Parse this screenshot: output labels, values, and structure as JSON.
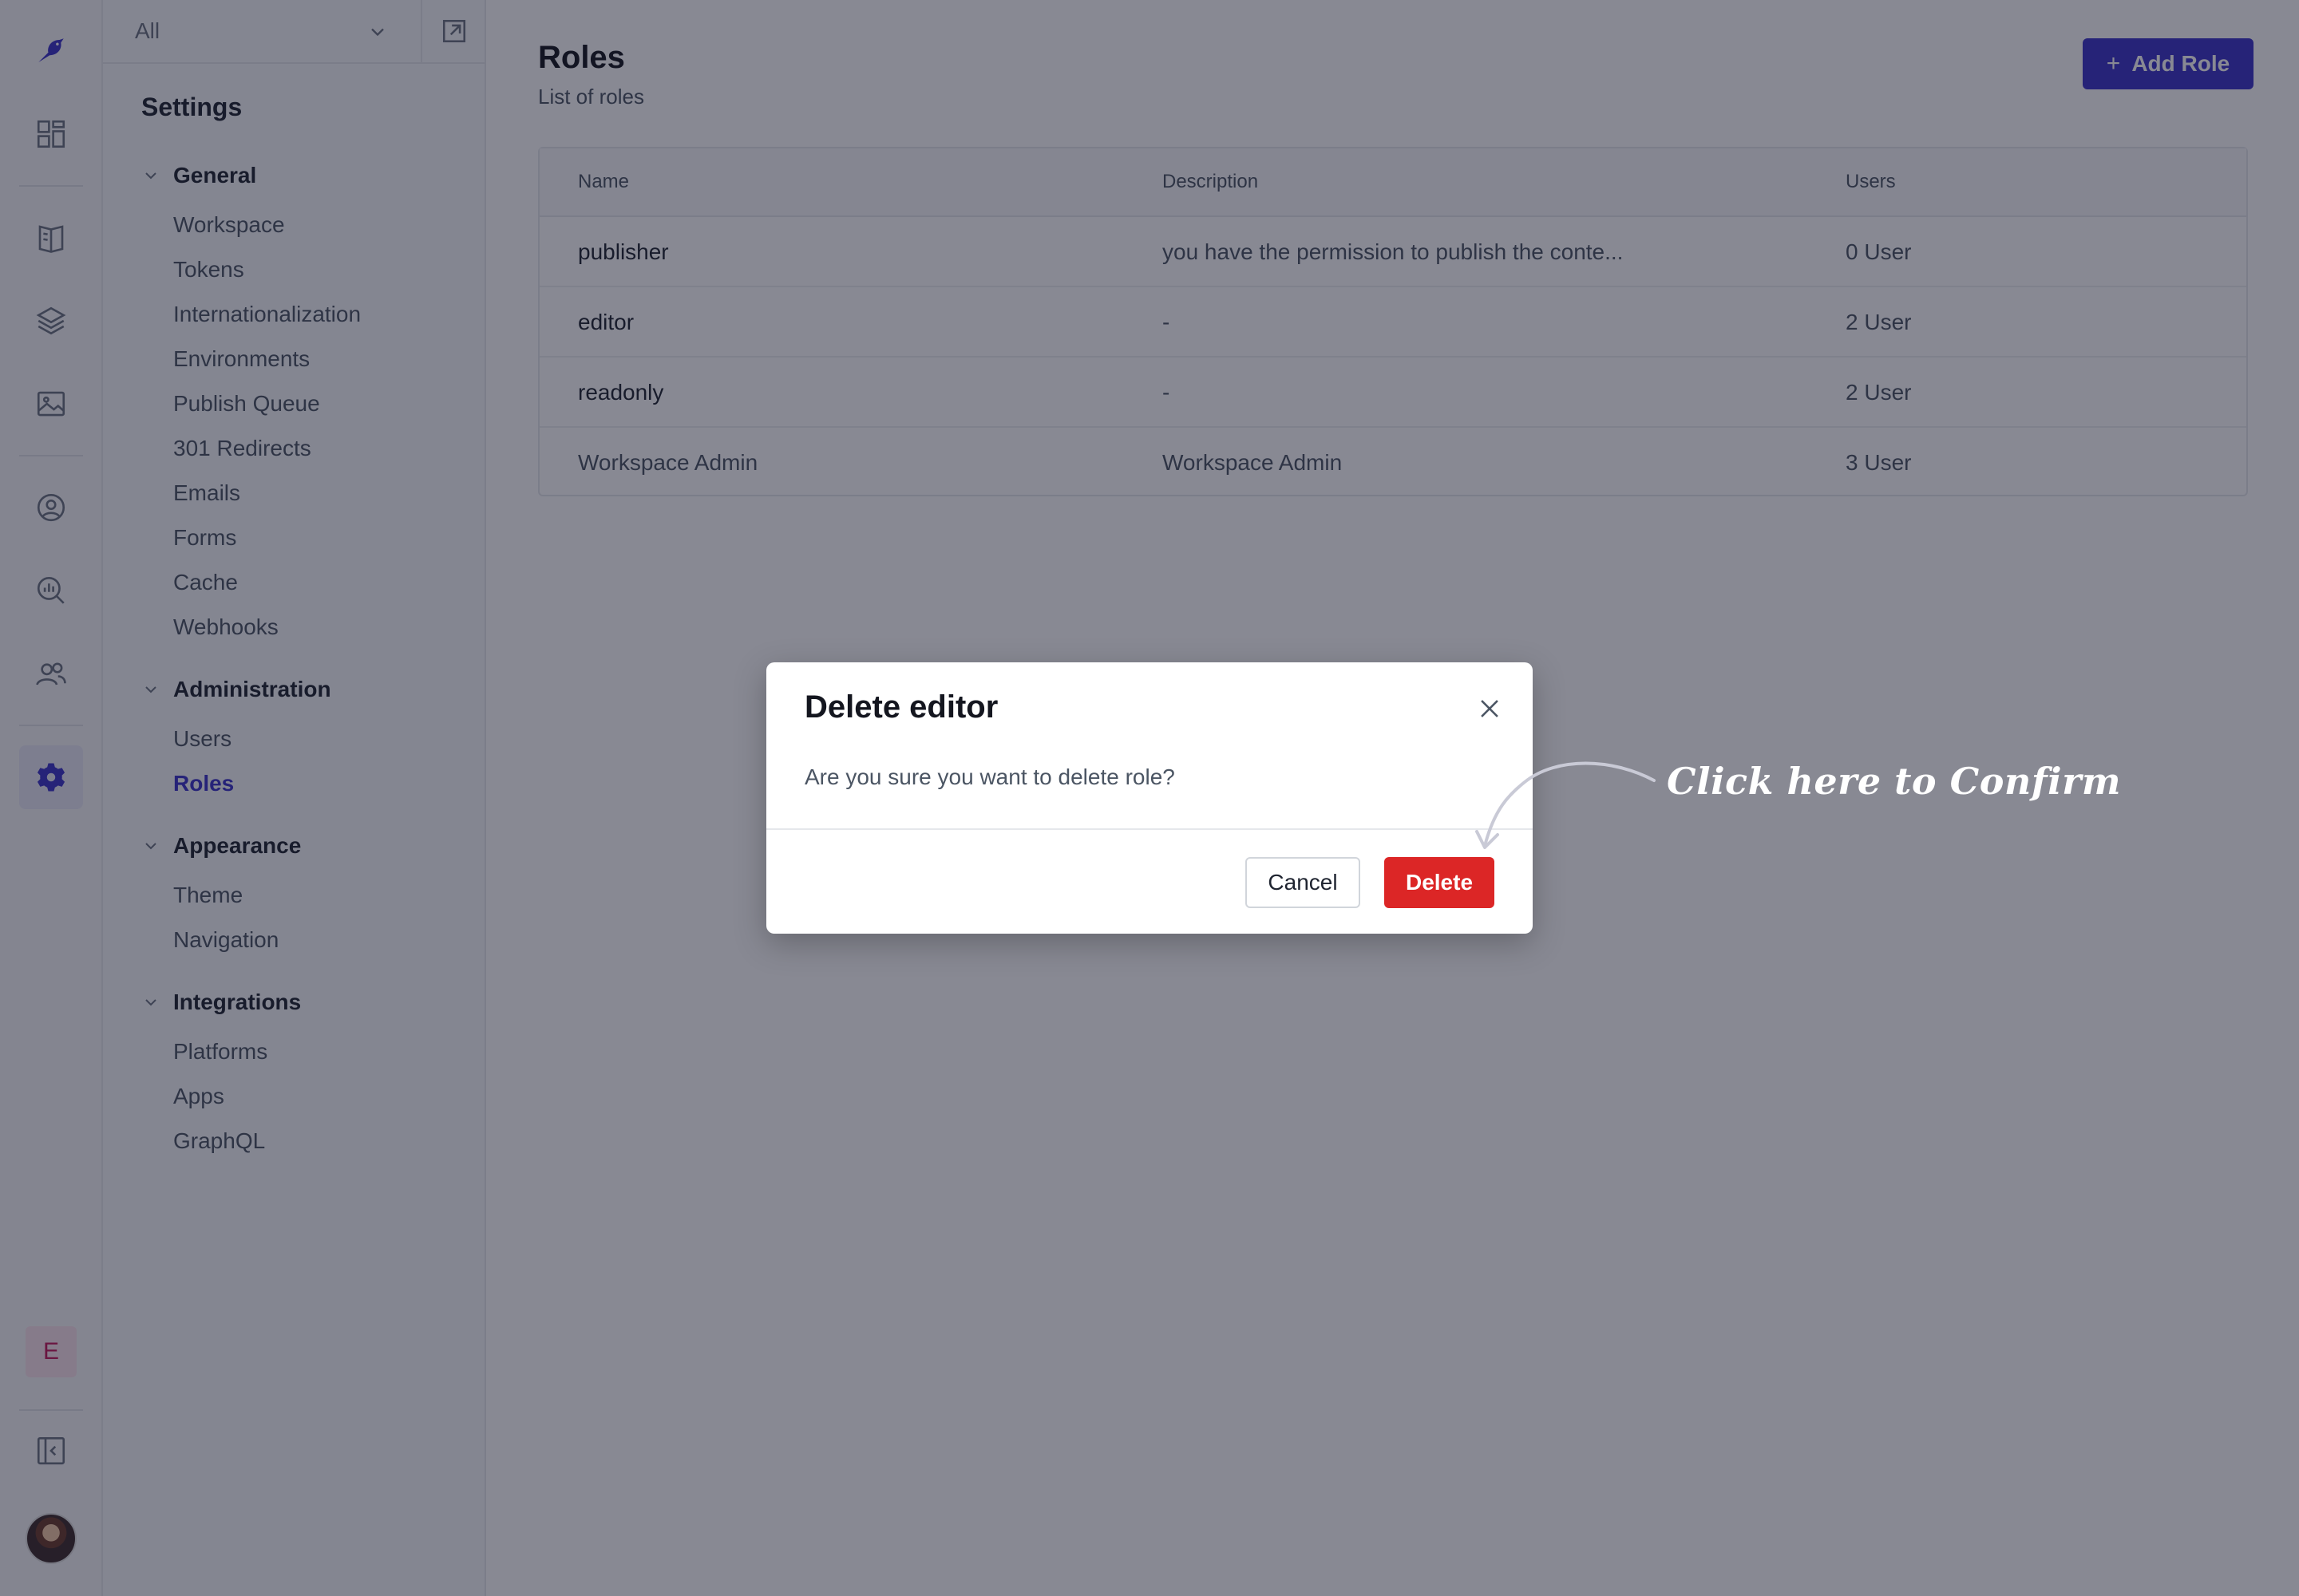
{
  "workspace_select": {
    "value": "All"
  },
  "sidebar": {
    "title": "Settings",
    "groups": [
      {
        "label": "General",
        "items": [
          "Workspace",
          "Tokens",
          "Internationalization",
          "Environments",
          "Publish Queue",
          "301 Redirects",
          "Emails",
          "Forms",
          "Cache",
          "Webhooks"
        ]
      },
      {
        "label": "Administration",
        "items": [
          "Users",
          "Roles"
        ]
      },
      {
        "label": "Appearance",
        "items": [
          "Theme",
          "Navigation"
        ]
      },
      {
        "label": "Integrations",
        "items": [
          "Platforms",
          "Apps",
          "GraphQL"
        ]
      }
    ],
    "active_item": "Roles"
  },
  "rail": {
    "icons": [
      "logo-bird-icon",
      "dashboard-icon",
      "book-icon",
      "layers-icon",
      "image-icon",
      "user-circle-icon",
      "analytics-icon",
      "team-icon",
      "gear-icon",
      "collapse-sidebar-icon"
    ],
    "workspace_badge": "E"
  },
  "page": {
    "title": "Roles",
    "subtitle": "List of roles",
    "add_button": "Add Role"
  },
  "table": {
    "headers": [
      "Name",
      "Description",
      "Users"
    ],
    "rows": [
      {
        "name": "publisher",
        "description": "you have the permission to publish the conte...",
        "users": "0 User"
      },
      {
        "name": "editor",
        "description": "-",
        "users": "2 User"
      },
      {
        "name": "readonly",
        "description": "-",
        "users": "2 User"
      },
      {
        "name": "Workspace Admin",
        "description": "Workspace Admin",
        "users": "3 User"
      }
    ]
  },
  "dialog": {
    "title": "Delete editor",
    "message": "Are you sure you want to delete role?",
    "cancel_label": "Cancel",
    "delete_label": "Delete"
  },
  "annotation": {
    "text": "Click here to Confirm"
  },
  "colors": {
    "accent": "#3b32c9",
    "danger": "#dc2626",
    "overlay": "rgba(18,20,40,0.5)"
  }
}
